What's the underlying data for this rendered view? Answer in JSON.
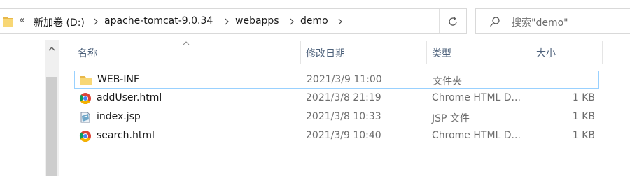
{
  "address": {
    "overflow": "«",
    "crumbs": [
      "新加卷 (D:)",
      "apache-tomcat-9.0.34",
      "webapps",
      "demo"
    ]
  },
  "search": {
    "placeholder": "搜索\"demo\""
  },
  "columns": {
    "name": "名称",
    "modified": "修改日期",
    "type": "类型",
    "size": "大小"
  },
  "files": [
    {
      "name": "WEB-INF",
      "modified": "2021/3/9 11:00",
      "type": "文件夹",
      "size": "",
      "icon": "folder-icon",
      "selected": true
    },
    {
      "name": "addUser.html",
      "modified": "2021/3/8 21:19",
      "type": "Chrome HTML D...",
      "size": "1 KB",
      "icon": "chrome-icon",
      "selected": false
    },
    {
      "name": "index.jsp",
      "modified": "2021/3/8 10:33",
      "type": "JSP 文件",
      "size": "1 KB",
      "icon": "jsp-file-icon",
      "selected": false
    },
    {
      "name": "search.html",
      "modified": "2021/3/9 10:40",
      "type": "Chrome HTML D...",
      "size": "1 KB",
      "icon": "chrome-icon",
      "selected": false
    }
  ],
  "colors": {
    "header_text": "#4c607a",
    "selection_border": "#99d1ff",
    "folder_yellow": "#f8d775"
  }
}
